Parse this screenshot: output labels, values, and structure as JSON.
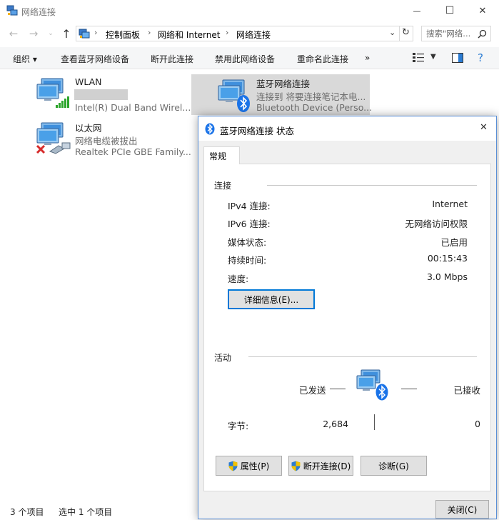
{
  "window": {
    "title": "网络连接",
    "minimize": "—",
    "maximize": "☐",
    "close": "✕"
  },
  "address": {
    "crumbs": [
      "控制面板",
      "网络和 Internet",
      "网络连接"
    ],
    "search_placeholder": "搜索\"网络..."
  },
  "toolbar": {
    "items": [
      "组织 ▾",
      "查看蓝牙网络设备",
      "断开此连接",
      "禁用此网络设备",
      "重命名此连接",
      "»"
    ]
  },
  "connections": [
    {
      "name": "WLAN",
      "line1": "",
      "line2": "Intel(R) Dual Band Wirel..."
    },
    {
      "name": "以太网",
      "line1": "网络电缆被拔出",
      "line2": "Realtek PCIe GBE Family..."
    },
    {
      "name": "蓝牙网络连接",
      "line1": "连接到 将要连接笔记本电...",
      "line2": "Bluetooth Device (Perso..."
    }
  ],
  "status_bar": {
    "count": "3 个项目",
    "selected": "选中 1 个项目"
  },
  "dialog": {
    "title": "蓝牙网络连接 状态",
    "close": "✕",
    "tab": "常规",
    "connection_group": "连接",
    "props": [
      {
        "label": "IPv4 连接:",
        "value": "Internet"
      },
      {
        "label": "IPv6 连接:",
        "value": "无网络访问权限"
      },
      {
        "label": "媒体状态:",
        "value": "已启用"
      },
      {
        "label": "持续时间:",
        "value": "00:15:43"
      },
      {
        "label": "速度:",
        "value": "3.0 Mbps"
      }
    ],
    "details_button": "详细信息(E)...",
    "activity_group": "活动",
    "sent_label": "已发送",
    "received_label": "已接收",
    "bytes_label": "字节:",
    "bytes_sent": "2,684",
    "bytes_received": "0",
    "properties_button": "属性(P)",
    "disconnect_button": "断开连接(D)",
    "diagnose_button": "诊断(G)",
    "close_button": "关闭(C)"
  },
  "colors": {
    "accent": "#0078d7",
    "bluetooth": "#1a73e8",
    "selection": "#d9d9d9"
  }
}
